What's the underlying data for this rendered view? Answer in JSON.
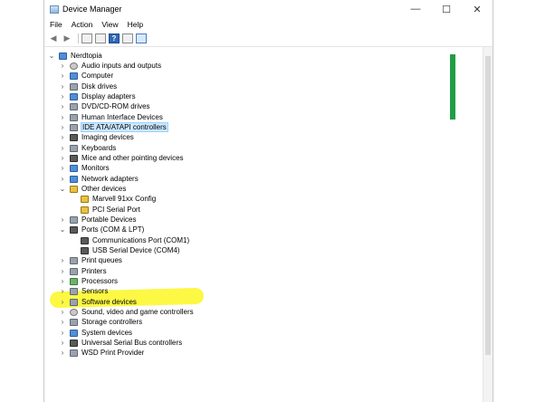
{
  "window": {
    "title": "Device Manager",
    "controls": {
      "minimize": "—",
      "maximize": "☐",
      "close": "✕"
    }
  },
  "menu": [
    "File",
    "Action",
    "View",
    "Help"
  ],
  "toolbar": {
    "help_glyph": "?"
  },
  "tree": {
    "root": "Nerdtopia",
    "items": [
      {
        "label": "Audio inputs and outputs"
      },
      {
        "label": "Computer"
      },
      {
        "label": "Disk drives"
      },
      {
        "label": "Display adapters"
      },
      {
        "label": "DVD/CD-ROM drives"
      },
      {
        "label": "Human Interface Devices"
      },
      {
        "label": "IDE ATA/ATAPI controllers"
      },
      {
        "label": "Imaging devices"
      },
      {
        "label": "Keyboards"
      },
      {
        "label": "Mice and other pointing devices"
      },
      {
        "label": "Monitors"
      },
      {
        "label": "Network adapters"
      },
      {
        "label": "Other devices"
      },
      {
        "label": "Marvell 91xx Config"
      },
      {
        "label": "PCI Serial Port"
      },
      {
        "label": "Portable Devices"
      },
      {
        "label": "Ports (COM & LPT)"
      },
      {
        "label": "Communications Port (COM1)"
      },
      {
        "label": "USB Serial Device (COM4)"
      },
      {
        "label": "Print queues"
      },
      {
        "label": "Printers"
      },
      {
        "label": "Processors"
      },
      {
        "label": "Sensors"
      },
      {
        "label": "Software devices"
      },
      {
        "label": "Sound, video and game controllers"
      },
      {
        "label": "Storage controllers"
      },
      {
        "label": "System devices"
      },
      {
        "label": "Universal Serial Bus controllers"
      },
      {
        "label": "WSD Print Provider"
      }
    ]
  },
  "glyphs": {
    "collapsed": "›",
    "expanded": "⌄"
  },
  "colors": {
    "highlight": "#fcf83a",
    "selection": "#cde8ff"
  }
}
